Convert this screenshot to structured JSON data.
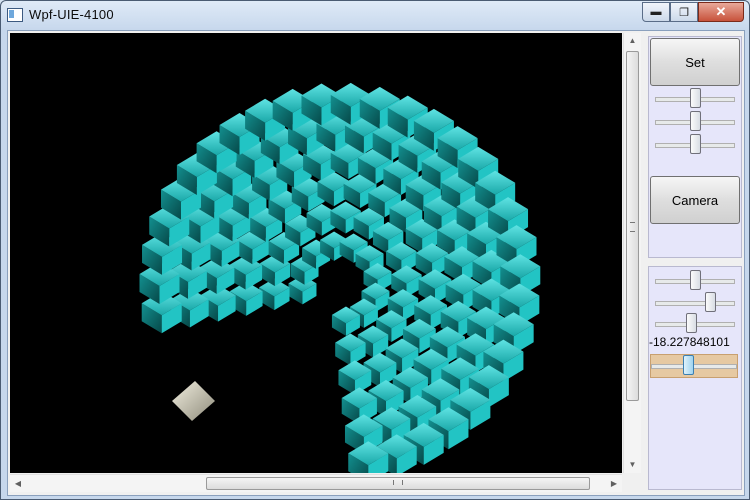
{
  "window": {
    "title": "Wpf-UIE-4100",
    "minimize_glyph": "▬",
    "maximize_glyph": "❐",
    "close_glyph": "✕"
  },
  "viewport": {
    "background": "#000000",
    "object_color": "#1fb5b5",
    "camera_marker_color": "#d8d4c0"
  },
  "panel_top": {
    "set_label": "Set",
    "camera_label": "Camera",
    "background": "#e6e6fa"
  },
  "panel_bottom": {
    "value_text": "-18.227848101",
    "background": "#e6e6fa"
  },
  "sliders": {
    "top_1": 0.5,
    "top_2": 0.5,
    "top_3": 0.5,
    "bottom_1": 0.5,
    "bottom_2": 0.72,
    "bottom_3": 0.45,
    "bottom_4_selected": 0.42
  },
  "icons": {
    "scroll_up": "▲",
    "scroll_down": "▼",
    "scroll_left": "◀",
    "scroll_right": "▶"
  }
}
